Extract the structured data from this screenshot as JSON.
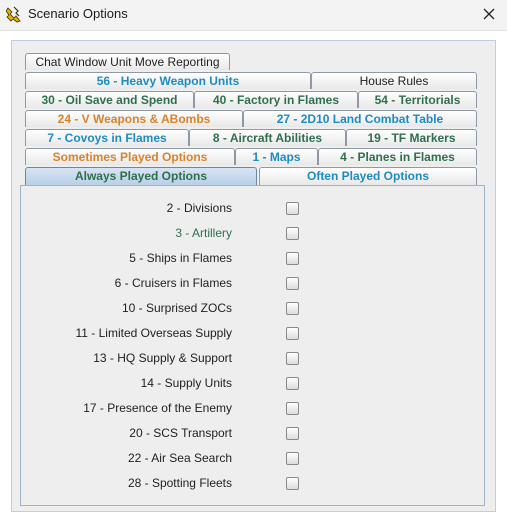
{
  "window": {
    "title": "Scenario Options",
    "app_icon": "game-app-icon",
    "close_icon": "close-icon"
  },
  "colors": {
    "blue_text": "#1e8bc3",
    "orange_text": "#d9832b",
    "green_text": "#2f6f4e",
    "dark_text": "#1f1f1f"
  },
  "tabs": [
    {
      "id": "chat-window",
      "label": "Chat Window Unit Move Reporting",
      "color": "#1f1f1f",
      "weight": "normal",
      "selected": false
    },
    {
      "id": "56",
      "label": "56 - Heavy Weapon Units",
      "color": "#1e8bc3",
      "weight": "bold",
      "selected": false
    },
    {
      "id": "house-rules",
      "label": "House Rules",
      "color": "#1f1f1f",
      "weight": "normal",
      "selected": false
    },
    {
      "id": "30",
      "label": "30 - Oil Save and Spend",
      "color": "#2f6f4e",
      "weight": "bold",
      "selected": false
    },
    {
      "id": "40",
      "label": "40 - Factory in Flames",
      "color": "#2f6f4e",
      "weight": "bold",
      "selected": false
    },
    {
      "id": "54",
      "label": "54 - Territorials",
      "color": "#2f6f4e",
      "weight": "bold",
      "selected": false
    },
    {
      "id": "24",
      "label": "24 - V Weapons & ABombs",
      "color": "#d9832b",
      "weight": "bold",
      "selected": false
    },
    {
      "id": "27",
      "label": "27 - 2D10 Land Combat Table",
      "color": "#1e8bc3",
      "weight": "bold",
      "selected": false
    },
    {
      "id": "7",
      "label": "7 - Covoys in Flames",
      "color": "#1e8bc3",
      "weight": "bold",
      "selected": false
    },
    {
      "id": "8",
      "label": "8 - Aircraft Abilities",
      "color": "#2f6f4e",
      "weight": "bold",
      "selected": false
    },
    {
      "id": "19",
      "label": "19 - TF Markers",
      "color": "#2f6f4e",
      "weight": "bold",
      "selected": false
    },
    {
      "id": "sometimes",
      "label": "Sometimes Played Options",
      "color": "#d9832b",
      "weight": "bold",
      "selected": false
    },
    {
      "id": "1",
      "label": "1 - Maps",
      "color": "#1e8bc3",
      "weight": "bold",
      "selected": false
    },
    {
      "id": "4",
      "label": "4 - Planes in Flames",
      "color": "#2f6f4e",
      "weight": "bold",
      "selected": false
    },
    {
      "id": "always",
      "label": "Always Played Options",
      "color": "#2f6f4e",
      "weight": "bold",
      "selected": true
    },
    {
      "id": "often",
      "label": "Often Played Options",
      "color": "#1e8bc3",
      "weight": "bold",
      "selected": false
    }
  ],
  "options": [
    {
      "label": "2 - Divisions",
      "color": "#1f1f1f",
      "checked": false
    },
    {
      "label": "3 - Artillery",
      "color": "#2f6f4e",
      "checked": false
    },
    {
      "label": "5 - Ships in Flames",
      "color": "#1f1f1f",
      "checked": false
    },
    {
      "label": "6 - Cruisers in Flames",
      "color": "#1f1f1f",
      "checked": false
    },
    {
      "label": "10 - Surprised ZOCs",
      "color": "#1f1f1f",
      "checked": false
    },
    {
      "label": "11 - Limited Overseas Supply",
      "color": "#1f1f1f",
      "checked": false
    },
    {
      "label": "13 - HQ Supply & Support",
      "color": "#1f1f1f",
      "checked": false
    },
    {
      "label": "14 - Supply Units",
      "color": "#1f1f1f",
      "checked": false
    },
    {
      "label": "17 - Presence of the Enemy",
      "color": "#1f1f1f",
      "checked": false
    },
    {
      "label": "20 - SCS Transport",
      "color": "#1f1f1f",
      "checked": false
    },
    {
      "label": "22 - Air Sea Search",
      "color": "#1f1f1f",
      "checked": false
    },
    {
      "label": "28 - Spotting Fleets",
      "color": "#1f1f1f",
      "checked": false
    }
  ]
}
